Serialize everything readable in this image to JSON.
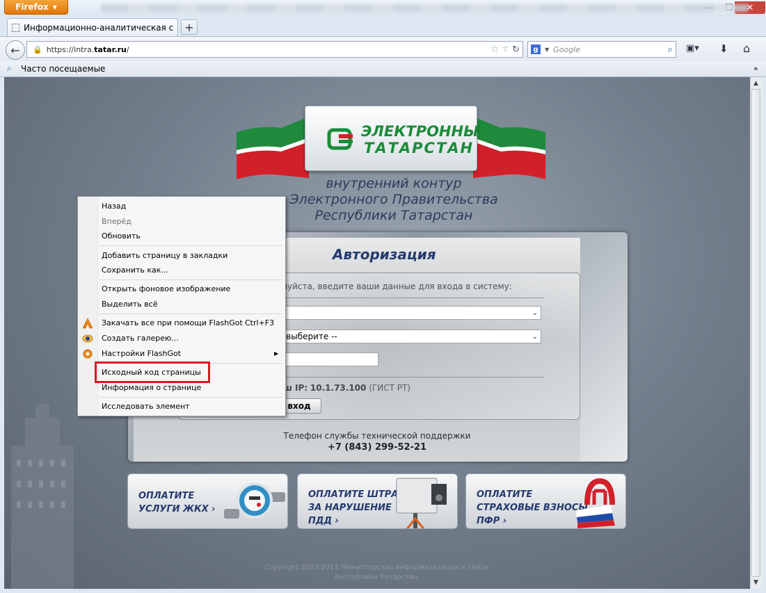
{
  "browser": {
    "app_button": "Firefox",
    "tab_title": "Информационно-аналитическая сист...",
    "url_prefix": "https://intra.",
    "url_domain": "tatar.ru",
    "url_suffix": "/",
    "search_placeholder": "Google",
    "bookmarks_label": "Часто посещаемые"
  },
  "logo": {
    "line1": "ЭЛЕКТРОННЫЙ",
    "line2": "ТАТАРСТАН",
    "subtitle_1": "внутренний контур",
    "subtitle_2": "Электронного Правительства",
    "subtitle_3": "Республики Татарстан"
  },
  "auth": {
    "title": "Авторизация",
    "hint": "алуйста, введите ваши данные для входа в систему:",
    "select2_value": "- выберите --",
    "ip_label": "аш IP:",
    "ip_value": "10.1.73.100",
    "ip_note": "(ГИСТ РТ)",
    "login_button": "вход"
  },
  "support": {
    "label": "Телефон службы технической поддержки",
    "phone": "+7 (843) 299-52-21"
  },
  "services": [
    {
      "line1": "ОПЛАТИТЕ",
      "line2": "УСЛУГИ ЖКХ ›",
      "line3": ""
    },
    {
      "line1": "ОПЛАТИТЕ ШТРАФЫ",
      "line2": "ЗА НАРУШЕНИЕ",
      "line3": "ПДД ›"
    },
    {
      "line1": "ОПЛАТИТЕ",
      "line2": "СТРАХОВЫЕ ВЗНОСЫ",
      "line3": "ПФР ›"
    }
  ],
  "copyright": {
    "line1": "Copyright 2003-2013 Министерство информатизации и связи",
    "line2": "Республики Татарстан"
  },
  "context_menu": {
    "items": [
      {
        "label": "Назад",
        "enabled": true
      },
      {
        "label": "Вперёд",
        "enabled": false
      },
      {
        "label": "Обновить",
        "enabled": true
      },
      {
        "label": "Добавить страницу в закладки",
        "enabled": true
      },
      {
        "label": "Сохранить как...",
        "enabled": true
      },
      {
        "label": "Открыть фоновое изображение",
        "enabled": true
      },
      {
        "label": "Выделить всё",
        "enabled": true
      },
      {
        "label": "Закачать все при помощи FlashGot",
        "enabled": true,
        "shortcut": "Ctrl+F3",
        "icon": "flashgot-icon"
      },
      {
        "label": "Создать галерею...",
        "enabled": true,
        "icon": "gallery-eye-icon"
      },
      {
        "label": "Настройки FlashGot",
        "enabled": true,
        "icon": "flashgot-settings-icon",
        "submenu": true
      },
      {
        "label": "Исходный код страницы",
        "enabled": true,
        "highlighted": true
      },
      {
        "label": "Информация о странице",
        "enabled": true
      },
      {
        "label": "Исследовать элемент",
        "enabled": true
      }
    ]
  },
  "colors": {
    "accent_green": "#1b8b3a",
    "title_blue": "#253a6e",
    "highlight_red": "#e0141e",
    "firefox_orange": "#e0760a"
  }
}
